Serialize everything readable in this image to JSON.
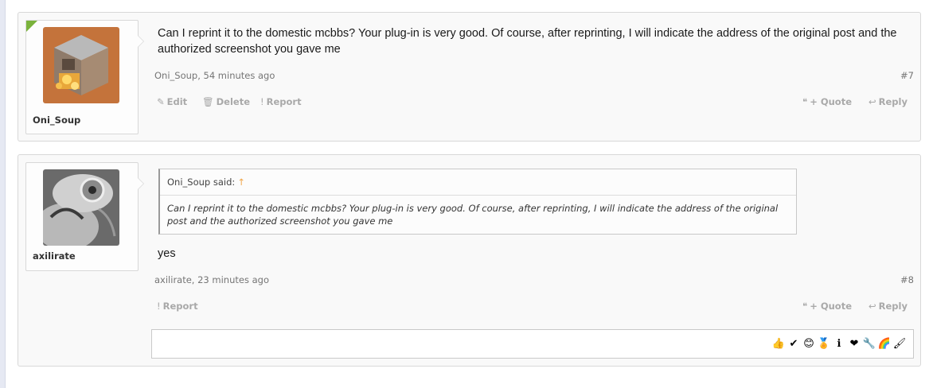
{
  "posts": [
    {
      "username": "Oni_Soup",
      "message": "Can I reprint it to the domestic mcbbs? Your plug-in is very good. Of course, after reprinting, I will indicate the address of the original post and the authorized screenshot you gave me",
      "author_time": "Oni_Soup, 54 minutes ago",
      "number": "#7",
      "actions": {
        "edit": "Edit",
        "delete": "Delete",
        "report": "Report",
        "quote": "+ Quote",
        "reply": "Reply"
      }
    },
    {
      "username": "axilirate",
      "quote_author": "Oni_Soup said:",
      "quote_text": "Can I reprint it to the domestic mcbbs? Your plug-in is very good. Of course, after reprinting, I will indicate the address of the original post and the authorized screenshot you gave me",
      "message": "yes",
      "author_time": "axilirate, 23 minutes ago",
      "number": "#8",
      "actions": {
        "report": "Report",
        "quote": "+ Quote",
        "reply": "Reply"
      }
    }
  ],
  "icons": {
    "edit": "✎",
    "delete": "🗑",
    "report": "!",
    "quote": "❝",
    "reply": "↩",
    "quote_arrow": "↑"
  },
  "emojis": [
    "👍",
    "✔",
    "😊",
    "🏅",
    "ℹ",
    "❤",
    "🔧",
    "🌈",
    "🖌"
  ],
  "colors": {
    "online": "#7ab23b",
    "quote_arrow": "#f0a64a",
    "action": "#a9a9a9"
  }
}
